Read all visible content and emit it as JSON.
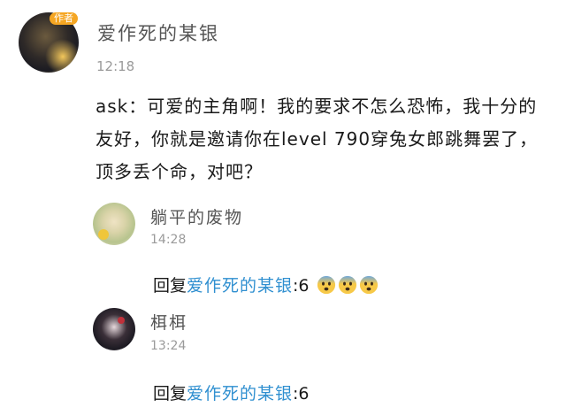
{
  "post": {
    "author_name": "爱作死的某银",
    "author_badge": "作者",
    "time": "12:18",
    "content": "ask：可爱的主角啊！我的要求不怎么恐怖，我十分的友好，你就是邀请你在level 790穿兔女郎跳舞罢了，顶多丢个命，对吧？"
  },
  "replies": [
    {
      "name": "躺平的废物",
      "time": "14:28",
      "reply_prefix": "回复",
      "mention": "爱作死的某银",
      "text": ":6",
      "emojis": [
        "fearful-face-emoji",
        "fearful-face-emoji",
        "fearful-face-emoji"
      ]
    },
    {
      "name": "栮栮",
      "time": "13:24",
      "reply_prefix": "回复",
      "mention": "爱作死的某银",
      "text": ":6"
    }
  ],
  "colors": {
    "mention": "#2f8fd0",
    "name": "#555555",
    "time": "#9a9a9a",
    "badge": "#f5a623"
  }
}
